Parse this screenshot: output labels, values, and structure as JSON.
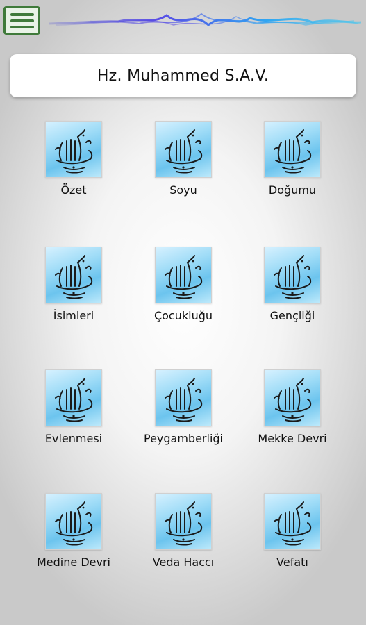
{
  "header": {
    "menu_icon": "hamburger-menu-icon",
    "title": "Hz. Muhammed S.A.V."
  },
  "tiles": [
    {
      "label": "Özet",
      "icon": "calligraphy-icon"
    },
    {
      "label": "Soyu",
      "icon": "calligraphy-icon"
    },
    {
      "label": "Doğumu",
      "icon": "calligraphy-icon"
    },
    {
      "label": "İsimleri",
      "icon": "calligraphy-icon"
    },
    {
      "label": "Çocukluğu",
      "icon": "calligraphy-icon"
    },
    {
      "label": "Gençliği",
      "icon": "calligraphy-icon"
    },
    {
      "label": "Evlenmesi",
      "icon": "calligraphy-icon"
    },
    {
      "label": "Peygamberliği",
      "icon": "calligraphy-icon"
    },
    {
      "label": "Mekke Devri",
      "icon": "calligraphy-icon"
    },
    {
      "label": "Medine Devri",
      "icon": "calligraphy-icon"
    },
    {
      "label": "Veda Haccı",
      "icon": "calligraphy-icon"
    },
    {
      "label": "Vefatı",
      "icon": "calligraphy-icon"
    }
  ],
  "colors": {
    "menu_green": "#3f7a3a",
    "tile_blue": "#6cc4ee"
  }
}
